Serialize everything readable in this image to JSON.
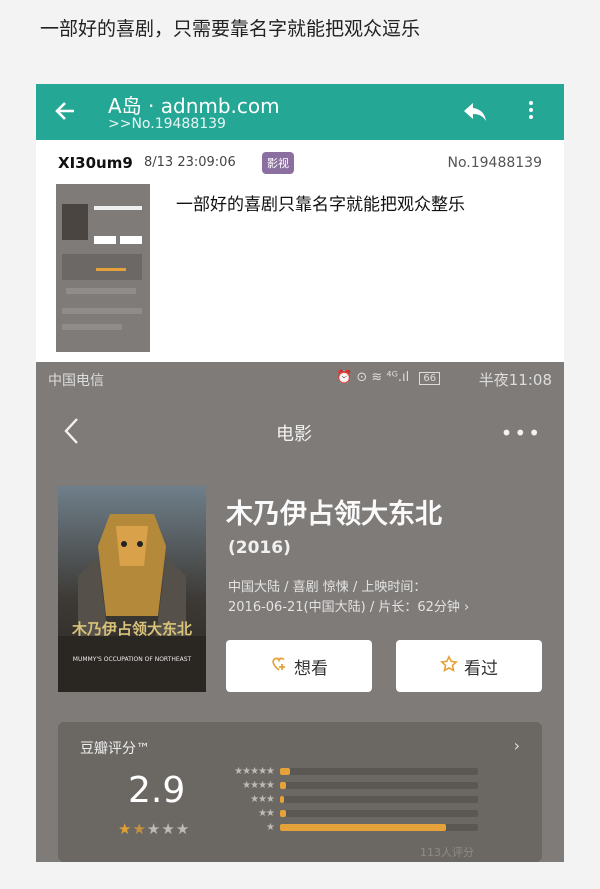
{
  "caption": "一部好的喜剧，只需要靠名字就能把观众逗乐",
  "appbar": {
    "site_title": "A岛 · adnmb.com",
    "thread_no": ">>No.19488139",
    "back_icon": "back-arrow-icon",
    "reply_icon": "reply-icon",
    "more_icon": "more-vertical-icon",
    "color": "#25a796"
  },
  "post": {
    "user": "XI30um9",
    "time": "8/13 23:09:06",
    "tag": "影视",
    "no": "No.19488139",
    "text": "一部好的喜剧只靠名字就能把观众整乐"
  },
  "screenshot": {
    "status": {
      "carrier": "中国电信",
      "icons": "⏰ ⊙ ≋ ⁴ᴳ.ıl",
      "battery": "66",
      "time": "半夜11:08"
    },
    "nav": {
      "title": "电影",
      "more": "•••"
    },
    "movie": {
      "title": "木乃伊占领大东北",
      "year": "(2016)",
      "meta_line1": "中国大陆 / 喜剧 惊悚 / 上映时间：",
      "meta_line2": "2016-06-21(中国大陆) / 片长：62分钟 ›",
      "poster_title": "木乃伊占领大东北",
      "poster_subtitle": "MUMMY'S OCCUPATION OF NORTHEAST"
    },
    "buttons": {
      "want": "想看",
      "seen": "看过"
    },
    "rating": {
      "label": "豆瓣评分™",
      "chevron": "›",
      "score": "2.9",
      "stars_filled": 1.5,
      "stars_total": 5,
      "count": "113人评分",
      "distribution": [
        {
          "stars": "★★★★★",
          "fraction": 0.05
        },
        {
          "stars": "★★★★",
          "fraction": 0.03
        },
        {
          "stars": "★★★",
          "fraction": 0.02
        },
        {
          "stars": "★★",
          "fraction": 0.03
        },
        {
          "stars": "★",
          "fraction": 0.84
        }
      ]
    }
  }
}
